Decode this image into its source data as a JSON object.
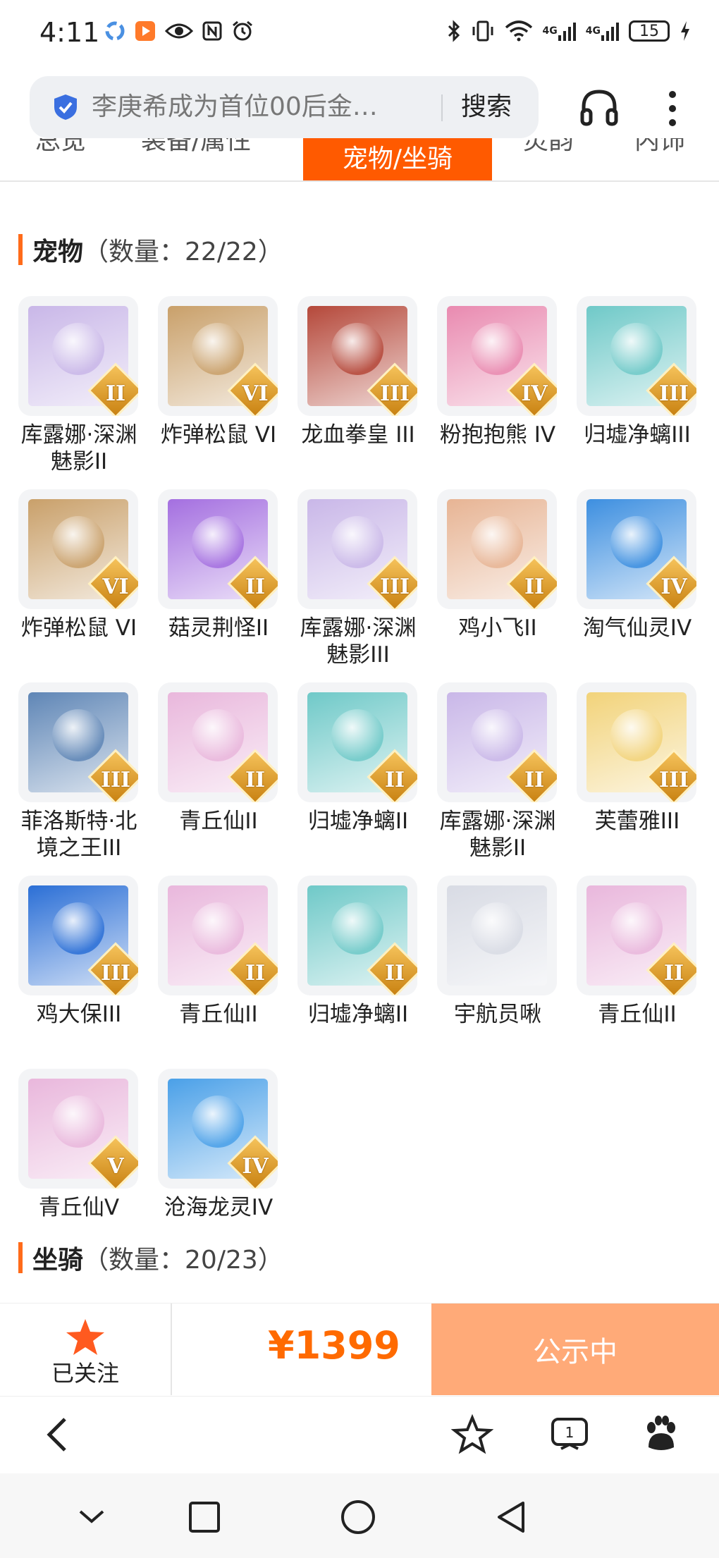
{
  "status_bar": {
    "time": "4:11",
    "battery": "15",
    "network1": "4G",
    "network2": "4G"
  },
  "search": {
    "text": "李庚希成为首位00后金…",
    "button": "搜索"
  },
  "tabs": [
    "总览",
    "装备/属性",
    "宠物/坐骑",
    "灵韵",
    "内饰"
  ],
  "pets_section": {
    "title": "宠物",
    "count": "（数量：22/22）"
  },
  "pets": [
    {
      "name": "库露娜·深渊魅影II",
      "grade": "II",
      "color": "#c9b7e8"
    },
    {
      "name": "炸弹松鼠 VI",
      "grade": "VI",
      "color": "#c9a06a"
    },
    {
      "name": "龙血拳皇 III",
      "grade": "III",
      "color": "#b5483a"
    },
    {
      "name": "粉抱抱熊 IV",
      "grade": "IV",
      "color": "#e98ab0"
    },
    {
      "name": "归墟净螭III",
      "grade": "III",
      "color": "#6fc9c8"
    },
    {
      "name": "炸弹松鼠 VI",
      "grade": "VI",
      "color": "#c9a06a"
    },
    {
      "name": "菇灵荆怪II",
      "grade": "II",
      "color": "#a46fe0"
    },
    {
      "name": "库露娜·深渊魅影III",
      "grade": "III",
      "color": "#c9b7e8"
    },
    {
      "name": "鸡小飞II",
      "grade": "II",
      "color": "#e7b494"
    },
    {
      "name": "淘气仙灵IV",
      "grade": "IV",
      "color": "#3d8fe0"
    },
    {
      "name": "菲洛斯特·北境之王III",
      "grade": "III",
      "color": "#5f86b6"
    },
    {
      "name": "青丘仙II",
      "grade": "II",
      "color": "#e9b7dc"
    },
    {
      "name": "归墟净螭II",
      "grade": "II",
      "color": "#6fc9c8"
    },
    {
      "name": "库露娜·深渊魅影II",
      "grade": "II",
      "color": "#c9b7e8"
    },
    {
      "name": "芙蕾雅III",
      "grade": "III",
      "color": "#f2d37a"
    },
    {
      "name": "鸡大保III",
      "grade": "III",
      "color": "#2b6fd6"
    },
    {
      "name": "青丘仙II",
      "grade": "II",
      "color": "#e9b7dc"
    },
    {
      "name": "归墟净螭II",
      "grade": "II",
      "color": "#6fc9c8"
    },
    {
      "name": "宇航员啾",
      "grade": "",
      "color": "#d8dbe4"
    },
    {
      "name": "青丘仙II",
      "grade": "II",
      "color": "#e9b7dc"
    },
    {
      "name": "青丘仙V",
      "grade": "V",
      "color": "#e9b7dc"
    },
    {
      "name": "沧海龙灵IV",
      "grade": "IV",
      "color": "#4aa0e8"
    }
  ],
  "mounts_section": {
    "title": "坐骑",
    "count": "（数量：20/23）"
  },
  "footer": {
    "follow_label": "已关注",
    "price": "¥1399",
    "status": "公示中"
  },
  "colors": {
    "accent": "#ff6a00",
    "status_btn": "#ffaa78",
    "follow_star": "#ff5a1f"
  }
}
